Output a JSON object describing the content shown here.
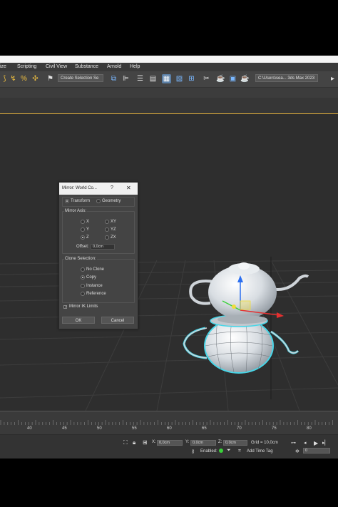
{
  "menu": [
    "ize",
    "Scripting",
    "Civil View",
    "Substance",
    "Arnold",
    "Help"
  ],
  "toolbar": {
    "selection_set": "Create Selection Se",
    "path": "C:\\Users\\sea... 3ds Max 2023"
  },
  "dialog": {
    "title": "Mirror: World Co...",
    "help": "?",
    "close": "✕",
    "mode_transform": "Transform",
    "mode_geometry": "Geometry",
    "mirror_axis_label": "Mirror Axis:",
    "axes": [
      "X",
      "Y",
      "Z",
      "XY",
      "YZ",
      "ZX"
    ],
    "selected_axis": "Z",
    "offset_label": "Offset:",
    "offset_value": "0,0cm",
    "clone_label": "Clone Selection:",
    "clone_options": [
      "No Clone",
      "Copy",
      "Instance",
      "Reference"
    ],
    "selected_clone": "Copy",
    "mirror_ik": "Mirror IK Limits",
    "ok": "OK",
    "cancel": "Cancel"
  },
  "timeline": {
    "ticks": [
      "40",
      "45",
      "50",
      "55",
      "60",
      "65",
      "70",
      "75",
      "80"
    ]
  },
  "status": {
    "x_label": "X:",
    "x_value": "0,0cm",
    "y_label": "Y:",
    "y_value": "0,0cm",
    "z_label": "Z:",
    "z_value": "0,0cm",
    "grid": "Grid = 10,0cm",
    "enabled": "Enabled:",
    "add_time_tag": "Add Time Tag",
    "frame": "0"
  },
  "colors": {
    "selection": "#47d6e8",
    "teapot": "#d8dde2",
    "accent": "#d9a93c"
  }
}
